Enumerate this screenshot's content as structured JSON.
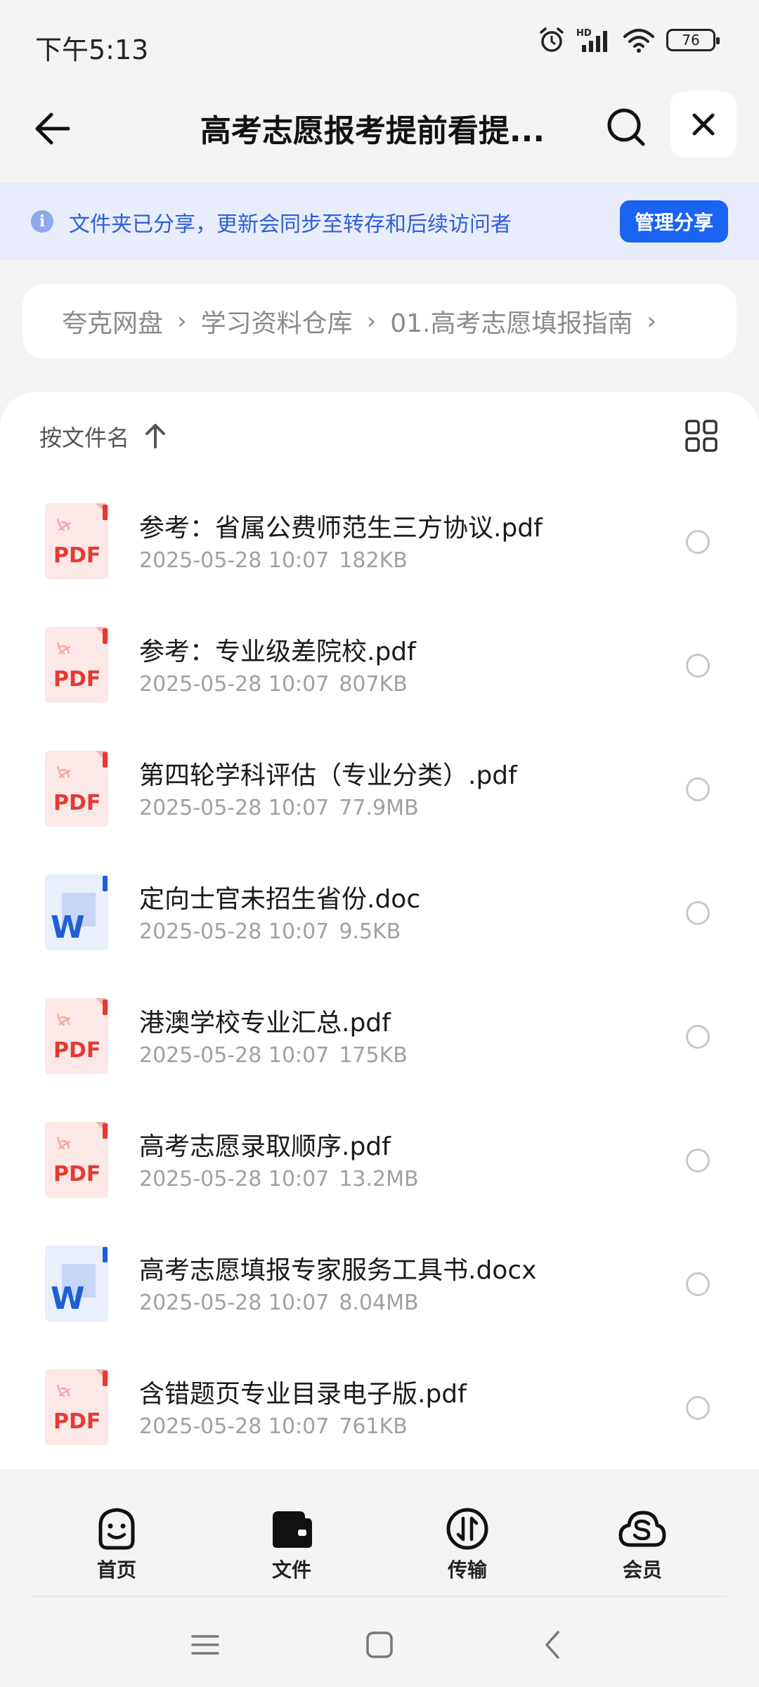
{
  "status_bar": {
    "time": "下午5:13",
    "battery": "76",
    "icons": [
      "alarm-icon",
      "hd-signal-icon",
      "wifi-icon",
      "battery-icon"
    ]
  },
  "header": {
    "title": "高考志愿报考提前看提...",
    "back_icon": "arrow-left-icon",
    "search_icon": "search-icon",
    "close_icon": "close-icon"
  },
  "share_banner": {
    "text": "文件夹已分享，更新会同步至转存和后续访问者",
    "button": "管理分享",
    "accent": "#1a63f3"
  },
  "breadcrumb": {
    "items": [
      "夸克网盘",
      "学习资料仓库",
      "01.高考志愿填报指南"
    ]
  },
  "list": {
    "sort_label": "按文件名",
    "files": [
      {
        "name": "参考：省属公费师范生三方协议.pdf",
        "date": "2025-05-28 10:07",
        "size": "182KB",
        "type": "pdf"
      },
      {
        "name": "参考：专业级差院校.pdf",
        "date": "2025-05-28 10:07",
        "size": "807KB",
        "type": "pdf"
      },
      {
        "name": "第四轮学科评估（专业分类）.pdf",
        "date": "2025-05-28 10:07",
        "size": "77.9MB",
        "type": "pdf"
      },
      {
        "name": "定向士官未招生省份.doc",
        "date": "2025-05-28 10:07",
        "size": "9.5KB",
        "type": "word"
      },
      {
        "name": "港澳学校专业汇总.pdf",
        "date": "2025-05-28 10:07",
        "size": "175KB",
        "type": "pdf"
      },
      {
        "name": "高考志愿录取顺序.pdf",
        "date": "2025-05-28 10:07",
        "size": "13.2MB",
        "type": "pdf"
      },
      {
        "name": "高考志愿填报专家服务工具书.docx",
        "date": "2025-05-28 10:07",
        "size": "8.04MB",
        "type": "word"
      },
      {
        "name": "含错题页专业目录电子版.pdf",
        "date": "2025-05-28 10:07",
        "size": "761KB",
        "type": "pdf"
      }
    ]
  },
  "bottom_nav": {
    "items": [
      {
        "label": "首页",
        "icon": "smiley-home-icon"
      },
      {
        "label": "文件",
        "icon": "folder-icon"
      },
      {
        "label": "传输",
        "icon": "transfer-icon"
      },
      {
        "label": "会员",
        "icon": "cloud-member-icon"
      }
    ]
  },
  "colors": {
    "pdf_red": "#e33b32",
    "word_blue": "#1d5fd6",
    "banner_bg": "#e9ecfa"
  }
}
